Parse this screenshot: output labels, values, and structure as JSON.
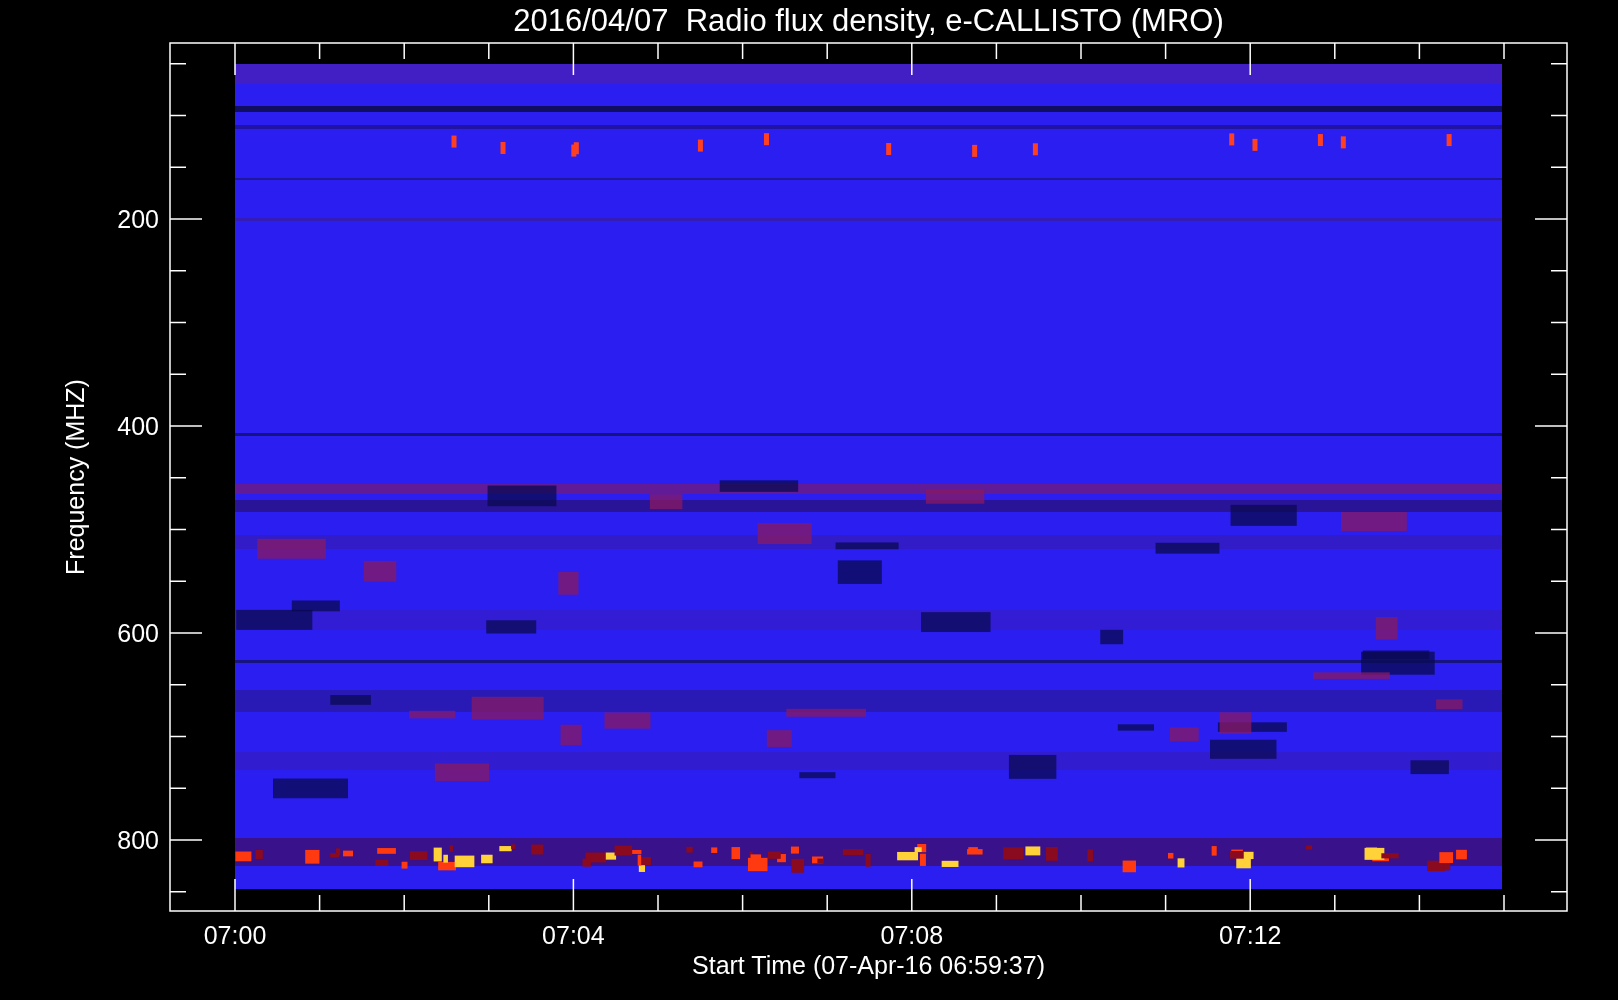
{
  "plot": {
    "title": "2016/04/07  Radio flux density, e-CALLISTO (MRO)",
    "ylabel": "Frequency (MHZ)",
    "xlabel": "Start Time (07-Apr-16 06:59:37)",
    "yticks": [
      "200",
      "400",
      "600",
      "800"
    ],
    "xticks": [
      "07:00",
      "07:04",
      "07:08",
      "07:12"
    ]
  }
}
